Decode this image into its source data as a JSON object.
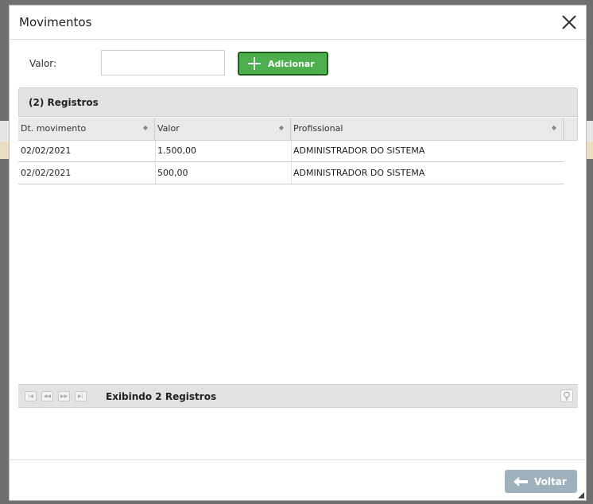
{
  "dialog": {
    "title": "Movimentos",
    "close_icon": "close-icon"
  },
  "form": {
    "valor_label": "Valor:",
    "valor_value": "",
    "add_button_label": "Adicionar",
    "add_icon": "plus-icon"
  },
  "grid": {
    "title": "(2) Registros",
    "columns": [
      "Dt. movimento",
      "Valor",
      "Profissional"
    ],
    "rows": [
      [
        "02/02/2021",
        "1.500,00",
        "ADMINISTRADOR DO SISTEMA"
      ],
      [
        "02/02/2021",
        "500,00",
        "ADMINISTRADOR DO SISTEMA"
      ]
    ],
    "pager_text": "Exibindo 2 Registros",
    "pager_icons": [
      "first-page-icon",
      "prev-page-icon",
      "next-page-icon",
      "last-page-icon",
      "lightbulb-icon"
    ]
  },
  "footer": {
    "voltar_label": "Voltar",
    "voltar_icon": "arrow-left-icon",
    "voltar_color": "#9fb1bc"
  },
  "colors": {
    "accent_green": "#4cae4c",
    "header_gray": "#e3e3e3"
  }
}
